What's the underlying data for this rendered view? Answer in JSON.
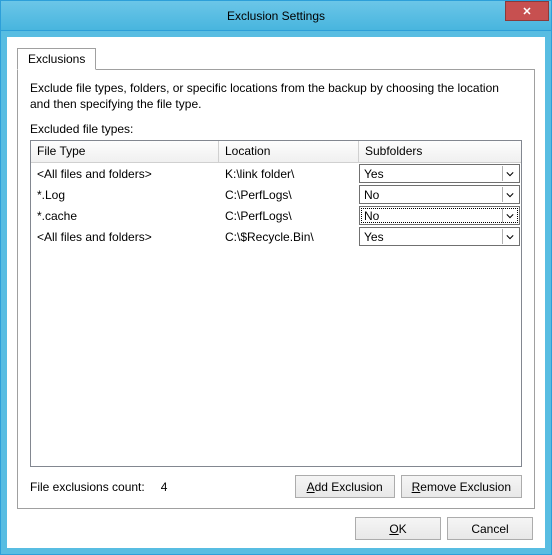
{
  "window": {
    "title": "Exclusion Settings",
    "close_glyph": "✕"
  },
  "tab": {
    "label": "Exclusions"
  },
  "panel": {
    "description": "Exclude file types, folders, or specific locations from the backup by choosing the location and then specifying the file type.",
    "list_label": "Excluded file types:"
  },
  "grid": {
    "headers": {
      "file_type": "File Type",
      "location": "Location",
      "subfolders": "Subfolders"
    },
    "rows": [
      {
        "file_type": "<All files and folders>",
        "location": "K:\\link folder\\",
        "subfolders": "Yes",
        "focused": false
      },
      {
        "file_type": "*.Log",
        "location": "C:\\PerfLogs\\",
        "subfolders": "No",
        "focused": false
      },
      {
        "file_type": "*.cache",
        "location": "C:\\PerfLogs\\",
        "subfolders": "No",
        "focused": true
      },
      {
        "file_type": "<All files and folders>",
        "location": "C:\\$Recycle.Bin\\",
        "subfolders": "Yes",
        "focused": false
      }
    ]
  },
  "count": {
    "label": "File exclusions count:",
    "value": "4"
  },
  "buttons": {
    "add": {
      "u": "A",
      "rest": "dd Exclusion"
    },
    "remove": {
      "u": "R",
      "rest": "emove Exclusion"
    },
    "ok": {
      "u": "O",
      "rest": "K"
    },
    "cancel": "Cancel"
  }
}
